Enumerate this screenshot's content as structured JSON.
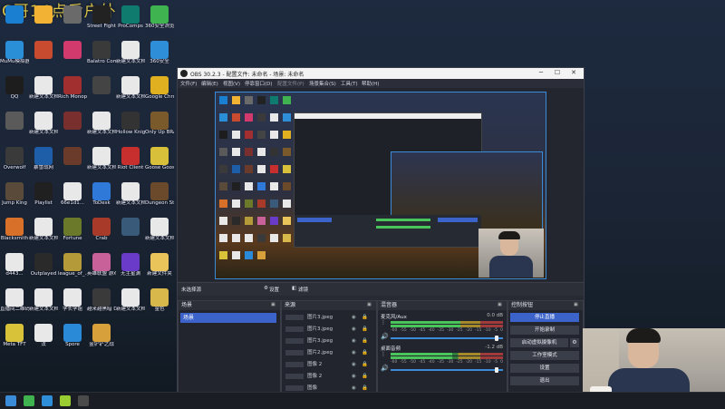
{
  "overlay_text": "C哥14点后户外",
  "desktop_icons": [
    {
      "label": "",
      "color": "#1a7fd1"
    },
    {
      "label": "",
      "color": "#f2b234"
    },
    {
      "label": "",
      "color": "#6a6a6a"
    },
    {
      "label": "Street Fighter 6",
      "color": "#222222"
    },
    {
      "label": "ProComps",
      "color": "#0f7b6f"
    },
    {
      "label": "360安全浏览器",
      "color": "#3fb34f"
    },
    {
      "label": "MuMu模拟器",
      "color": "#2b8fd8"
    },
    {
      "label": "",
      "color": "#c94b2f"
    },
    {
      "label": "",
      "color": "#d23a6e"
    },
    {
      "label": "Balatro Company",
      "color": "#3a3a3a"
    },
    {
      "label": "新建文本文档",
      "color": "#e8e8e8"
    },
    {
      "label": "360安全",
      "color": "#2f8ed8"
    },
    {
      "label": "QQ",
      "color": "#1d1d1d"
    },
    {
      "label": "新建文本文档",
      "color": "#e8e8e8"
    },
    {
      "label": "Rich Monopoly",
      "color": "#a12f2f"
    },
    {
      "label": "",
      "color": "#444444"
    },
    {
      "label": "新建文本文档",
      "color": "#e8e8e8"
    },
    {
      "label": "Google Chrome",
      "color": "#e0b020"
    },
    {
      "label": "",
      "color": "#5a5a5a"
    },
    {
      "label": "新建文本文档",
      "color": "#e8e8e8"
    },
    {
      "label": "",
      "color": "#7a2f2f"
    },
    {
      "label": "新建文本文档",
      "color": "#e8e8e8"
    },
    {
      "label": "Hollow Knight",
      "color": "#333333"
    },
    {
      "label": "Only Up BRAINR...",
      "color": "#7a5a2a"
    },
    {
      "label": "Overwolf",
      "color": "#3a3a3a"
    },
    {
      "label": "暴雪战网",
      "color": "#1e5ea8"
    },
    {
      "label": "",
      "color": "#6a3a2a"
    },
    {
      "label": "新建文本文档",
      "color": "#e8e8e8"
    },
    {
      "label": "Riot Client",
      "color": "#c72f2f"
    },
    {
      "label": "Goose Goose Duck",
      "color": "#d8c03a"
    },
    {
      "label": "Jump King",
      "color": "#5a4a3a"
    },
    {
      "label": "Playlist",
      "color": "#202020"
    },
    {
      "label": "66e1d1...",
      "color": "#e8e8e8"
    },
    {
      "label": "ToDesk",
      "color": "#2f7ad8"
    },
    {
      "label": "新建文本文档",
      "color": "#e8e8e8"
    },
    {
      "label": "Dungeon Stalkers",
      "color": "#6a4a2a"
    },
    {
      "label": "Blacksmith",
      "color": "#d8702a"
    },
    {
      "label": "新建文本文档",
      "color": "#e8e8e8"
    },
    {
      "label": "Fortune",
      "color": "#6a7a2a"
    },
    {
      "label": "Crab",
      "color": "#a83a2a"
    },
    {
      "label": "",
      "color": "#3a5a7a"
    },
    {
      "label": "新建文本文档",
      "color": "#e8e8e8"
    },
    {
      "label": "d443...",
      "color": "#e8e8e8"
    },
    {
      "label": "Outplayed",
      "color": "#2a2a2a"
    },
    {
      "label": "league_of_... 快捷方式",
      "color": "#b59a3a"
    },
    {
      "label": "英雄联盟 游戏测试",
      "color": "#c8609a"
    },
    {
      "label": "无主星渊",
      "color": "#6a3ac8"
    },
    {
      "label": "新建文件夹",
      "color": "#e8c45a"
    },
    {
      "label": "直播间二维码",
      "color": "#e8e8e8"
    },
    {
      "label": "新建文本文档",
      "color": "#e8e8e8"
    },
    {
      "label": "学长学姐",
      "color": "#e8e8e8"
    },
    {
      "label": "越来越黑暗 Dark an...",
      "color": "#3a3a3a"
    },
    {
      "label": "新建文本文档 (11)",
      "color": "#e8e8e8"
    },
    {
      "label": "金色",
      "color": "#d8b84a"
    },
    {
      "label": "Meta TFT",
      "color": "#d8c23a"
    },
    {
      "label": "法",
      "color": "#e8e8e8"
    },
    {
      "label": "Spore",
      "color": "#2a8ad8"
    },
    {
      "label": "金铲铲之战",
      "color": "#d8a03a"
    }
  ],
  "taskbar_icons": [
    {
      "name": "windows-start-icon",
      "color": "#3a8bd8"
    },
    {
      "name": "app-icon-1",
      "color": "#3fb34f"
    },
    {
      "name": "app-icon-2",
      "color": "#2f8ed8"
    },
    {
      "name": "app-icon-3",
      "color": "#9acd32"
    },
    {
      "name": "app-icon-4",
      "color": "#4a4a4a"
    }
  ],
  "obs": {
    "window_title": "OBS 30.2.3 - 配置文件: 未命名 - 场景: 未命名",
    "menus": [
      "文件(F)",
      "编辑(E)",
      "视图(V)",
      "停靠窗口(D)",
      "配置文件(P)",
      "场景集合(S)",
      "工具(T)",
      "帮助(H)"
    ],
    "nested_title": "OBS 30.2.3 - 配置文件: 未命名 - 场景: 未命名",
    "source_bar": {
      "name": "未选择源",
      "settings": "设置",
      "filters": "滤镜"
    },
    "scenes": {
      "title": "场景",
      "items": [
        "场景"
      ]
    },
    "sources": {
      "title": "来源",
      "items": [
        "图片3.jpeg",
        "图片3.jpeg",
        "图片3.jpeg",
        "图片2.jpeg",
        "图像 2",
        "图像 2",
        "图像"
      ]
    },
    "mixer": {
      "title": "混音器",
      "tracks": [
        {
          "name": "麦克风/Aux",
          "db": "0.0 dB",
          "level": 0.62,
          "volume": 0.96
        },
        {
          "name": "桌面音频",
          "db": "-1.2 dB",
          "level": 0.55,
          "volume": 0.96
        }
      ],
      "ticks": [
        "-60",
        "-55",
        "-50",
        "-45",
        "-40",
        "-35",
        "-30",
        "-25",
        "-20",
        "-15",
        "-10",
        "-5",
        "0"
      ]
    },
    "controls": {
      "title": "控制按钮",
      "buttons": [
        "停止直播",
        "开始录制",
        "启动虚拟摄像机",
        "工作室模式",
        "设置",
        "退出"
      ]
    }
  },
  "colors": {
    "accent": "#3b63c9",
    "preview_border": "#3a8bd8",
    "overlay": "#d8c24a"
  }
}
